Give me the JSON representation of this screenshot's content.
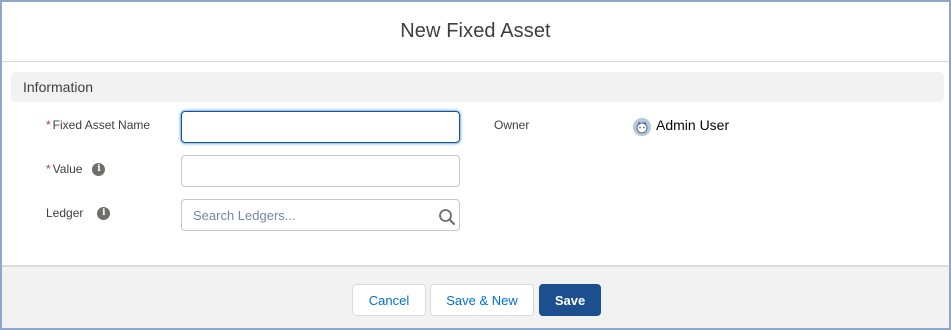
{
  "modal": {
    "title": "New Fixed Asset"
  },
  "section": {
    "title": "Information"
  },
  "fields": {
    "name": {
      "required_mark": "*",
      "label": "Fixed Asset Name",
      "value": ""
    },
    "value": {
      "required_mark": "*",
      "label": "Value",
      "info_icon": "info-icon",
      "value": ""
    },
    "ledger": {
      "label": "Ledger",
      "info_icon": "info-icon",
      "placeholder": "Search Ledgers...",
      "icon": "search-icon"
    }
  },
  "owner": {
    "label": "Owner",
    "value": "Admin User",
    "icon": "user-avatar-icon"
  },
  "footer": {
    "cancel_label": "Cancel",
    "save_new_label": "Save & New",
    "save_label": "Save"
  },
  "colors": {
    "brand": "#1b4f8f",
    "link": "#0070d2",
    "required": "#c23934",
    "section_bg": "#f3f2f2",
    "focus_border": "#1b5297"
  }
}
